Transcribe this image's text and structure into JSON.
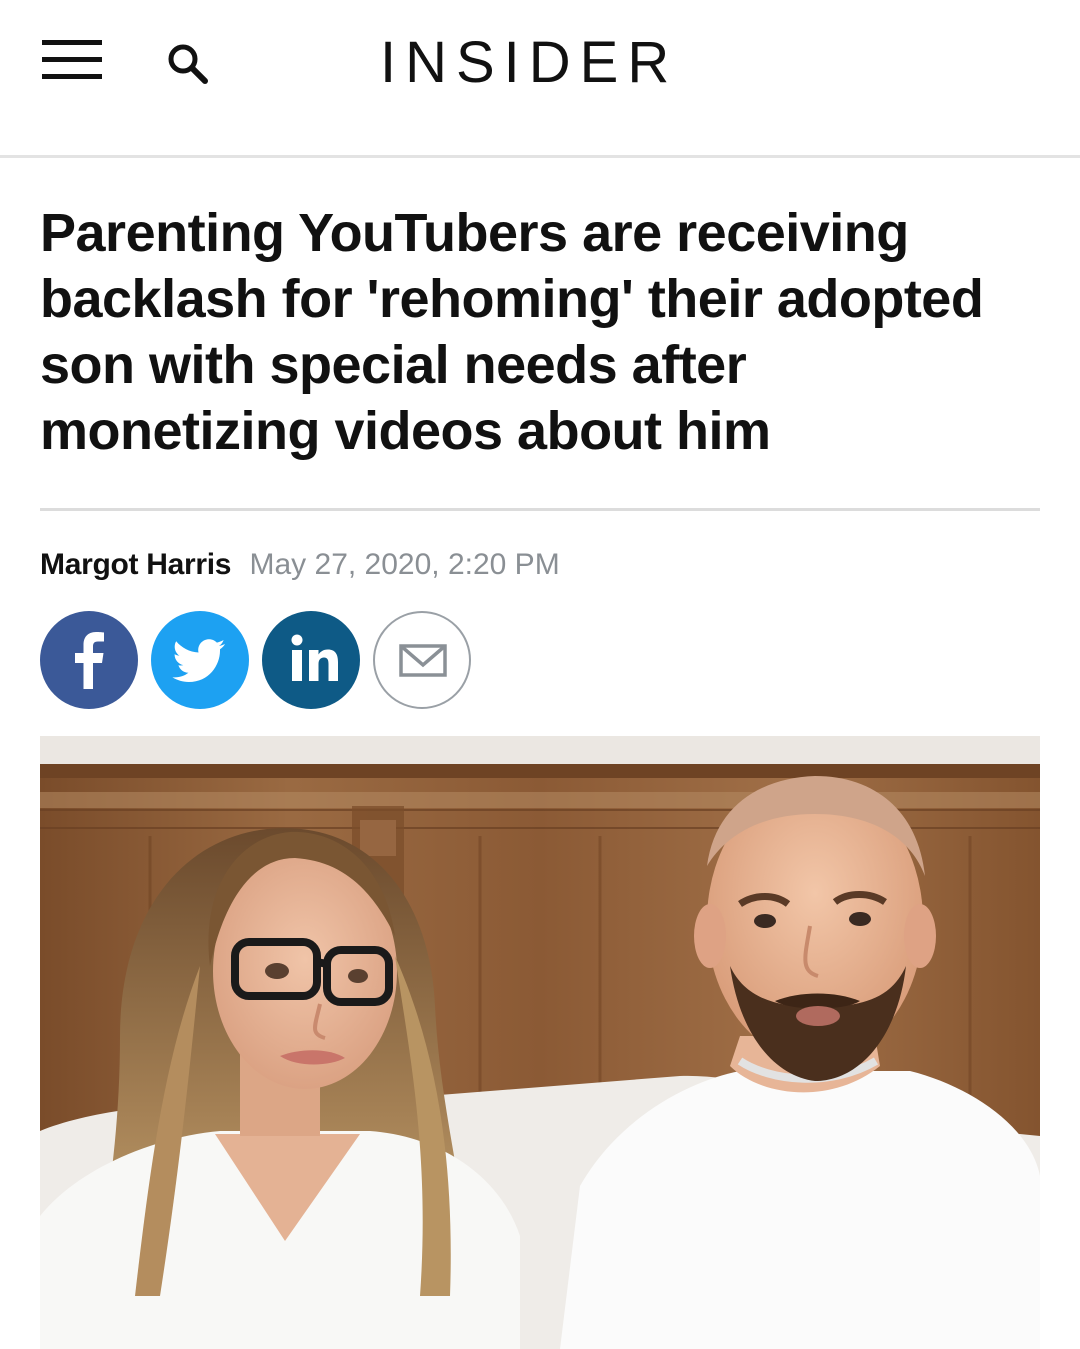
{
  "header": {
    "logo": "INSIDER",
    "menu_icon": "hamburger-menu-icon",
    "search_icon": "search-icon"
  },
  "article": {
    "headline": "Parenting YouTubers are receiving backlash for 'rehoming' their adopted son with special needs after monetizing videos about him",
    "author": "Margot Harris",
    "date": "May 27, 2020, 2:20 PM"
  },
  "share": [
    {
      "name": "facebook",
      "icon": "facebook-icon",
      "color": "#3b5998"
    },
    {
      "name": "twitter",
      "icon": "twitter-icon",
      "color": "#1da1f2"
    },
    {
      "name": "linkedin",
      "icon": "linkedin-icon",
      "color": "#0e5a86"
    },
    {
      "name": "email",
      "icon": "email-icon",
      "color": "#ffffff"
    }
  ],
  "colors": {
    "text": "#111111",
    "date": "#8a8f94",
    "divider": "#dcdcdc"
  }
}
